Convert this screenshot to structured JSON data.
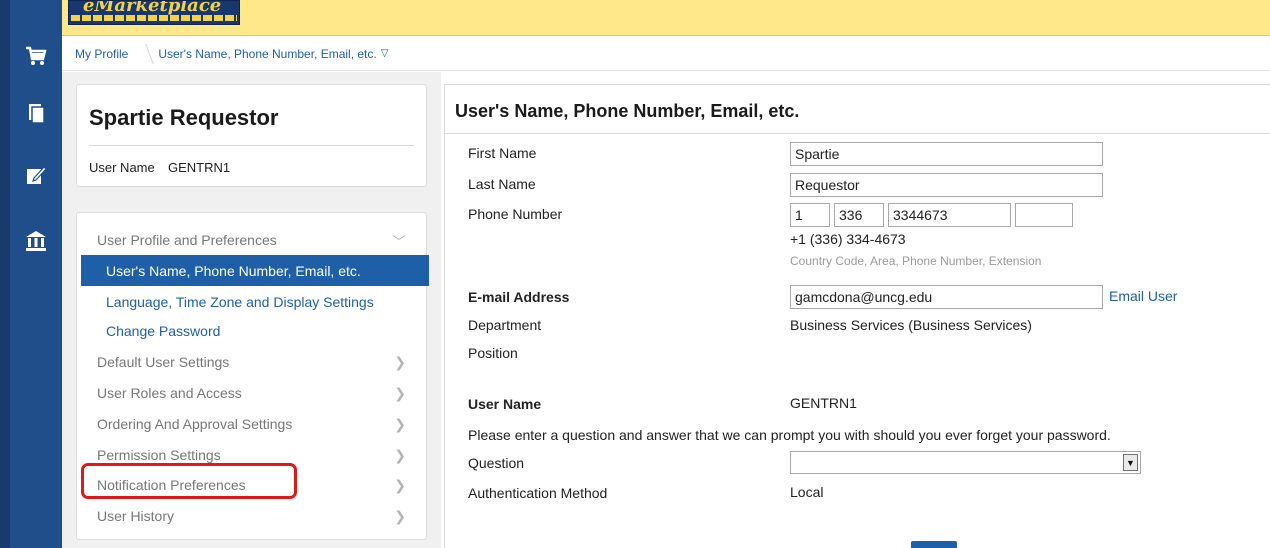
{
  "header": {
    "logo_text": "eMarketplace"
  },
  "rail": {
    "icons": [
      "cart-icon",
      "documents-icon",
      "edit-icon",
      "bank-icon"
    ]
  },
  "breadcrumb": {
    "root": "My Profile",
    "current": "User's Name, Phone Number, Email, etc."
  },
  "profile": {
    "name": "Spartie Requestor",
    "username_label": "User Name",
    "username_value": "GENTRN1"
  },
  "nav": {
    "section_profile": "User Profile and Preferences",
    "item_name_phone": "User's Name, Phone Number, Email, etc.",
    "item_language": "Language, Time Zone and Display Settings",
    "item_password": "Change Password",
    "section_default": "Default User Settings",
    "section_roles": "User Roles and Access",
    "section_ordering": "Ordering And Approval Settings",
    "section_permission": "Permission Settings",
    "section_notification": "Notification Preferences",
    "section_history": "User History"
  },
  "form": {
    "title": "User's Name, Phone Number, Email, etc.",
    "first_name_label": "First Name",
    "first_name_value": "Spartie",
    "last_name_label": "Last Name",
    "last_name_value": "Requestor",
    "phone_label": "Phone Number",
    "phone_country": "1",
    "phone_area": "336",
    "phone_number": "3344673",
    "phone_extension": "",
    "phone_formatted": "+1 (336) 334-4673",
    "phone_hint": "Country Code, Area, Phone Number, Extension",
    "email_label": "E-mail Address",
    "email_value": "gamcdona@uncg.edu",
    "email_user_link": "Email User",
    "department_label": "Department",
    "department_value": "Business Services (Business Services)",
    "position_label": "Position",
    "username_label": "User Name",
    "username_value": "GENTRN1",
    "security_prompt": "Please enter a question and answer that we can prompt you with should you ever forget your password.",
    "question_label": "Question",
    "question_value": "",
    "auth_label": "Authentication Method",
    "auth_value": "Local"
  },
  "colors": {
    "rail": "#1f4e8a",
    "topbar": "#ffe889",
    "accent": "#1f5fa8",
    "highlight": "#e01818"
  }
}
